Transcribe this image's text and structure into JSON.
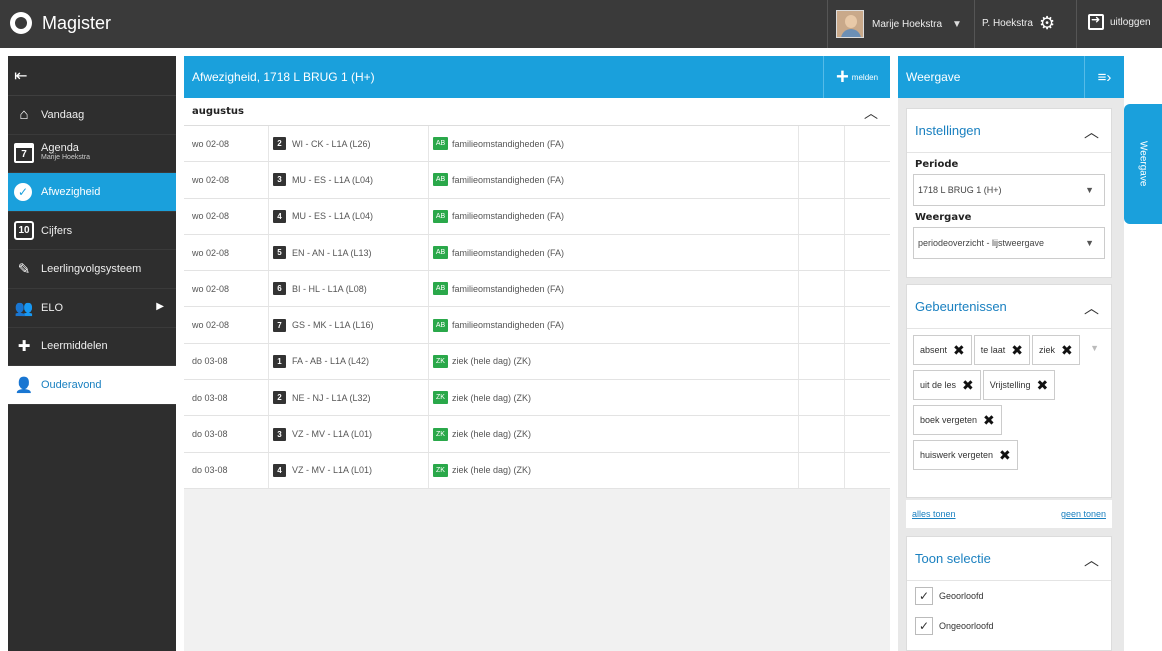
{
  "app": {
    "name": "Magister"
  },
  "topbar": {
    "user_name": "Marije Hoekstra",
    "account_name": "P. Hoekstra",
    "logout_label": "uitloggen"
  },
  "sidebar": {
    "items": [
      {
        "label": "Vandaag",
        "icon": "house-icon"
      },
      {
        "label": "Agenda",
        "sub": "Marije Hoekstra",
        "icon": "calendar-icon",
        "icon_text": "7"
      },
      {
        "label": "Afwezigheid",
        "icon": "check-circle-icon"
      },
      {
        "label": "Cijfers",
        "icon": "grade-icon",
        "icon_text": "10"
      },
      {
        "label": "Leerlingvolgsysteem",
        "icon": "pencil-icon"
      },
      {
        "label": "ELO",
        "icon": "people-icon"
      },
      {
        "label": "Leermiddelen",
        "icon": "puzzle-icon"
      },
      {
        "label": "Ouderavond",
        "icon": "parent-icon"
      }
    ],
    "active_index": 2,
    "selected_index": 7
  },
  "main": {
    "title": "Afwezigheid, 1718 L BRUG 1 (H+)",
    "melden_label": "melden",
    "month": "augustus",
    "rows": [
      {
        "date": "wo 02-08",
        "hour": "2",
        "les": "WI - CK - L1A (L26)",
        "code": "AB",
        "reason": "familieomstandigheden (FA)"
      },
      {
        "date": "wo 02-08",
        "hour": "3",
        "les": "MU - ES - L1A (L04)",
        "code": "AB",
        "reason": "familieomstandigheden (FA)"
      },
      {
        "date": "wo 02-08",
        "hour": "4",
        "les": "MU - ES - L1A (L04)",
        "code": "AB",
        "reason": "familieomstandigheden (FA)"
      },
      {
        "date": "wo 02-08",
        "hour": "5",
        "les": "EN - AN - L1A (L13)",
        "code": "AB",
        "reason": "familieomstandigheden (FA)"
      },
      {
        "date": "wo 02-08",
        "hour": "6",
        "les": "BI - HL - L1A (L08)",
        "code": "AB",
        "reason": "familieomstandigheden (FA)"
      },
      {
        "date": "wo 02-08",
        "hour": "7",
        "les": "GS - MK - L1A (L16)",
        "code": "AB",
        "reason": "familieomstandigheden (FA)"
      },
      {
        "date": "do 03-08",
        "hour": "1",
        "les": "FA - AB - L1A (L42)",
        "code": "ZK",
        "reason": "ziek (hele dag) (ZK)"
      },
      {
        "date": "do 03-08",
        "hour": "2",
        "les": "NE - NJ - L1A (L32)",
        "code": "ZK",
        "reason": "ziek (hele dag) (ZK)"
      },
      {
        "date": "do 03-08",
        "hour": "3",
        "les": "VZ - MV - L1A (L01)",
        "code": "ZK",
        "reason": "ziek (hele dag) (ZK)"
      },
      {
        "date": "do 03-08",
        "hour": "4",
        "les": "VZ - MV - L1A (L01)",
        "code": "ZK",
        "reason": "ziek (hele dag) (ZK)"
      }
    ]
  },
  "panel": {
    "title": "Weergave",
    "side_tab_label": "Weergave",
    "instellingen": {
      "title": "Instellingen",
      "periode_label": "Periode",
      "periode_value": "1718 L BRUG 1 (H+)",
      "weergave_label": "Weergave",
      "weergave_value": "periodeoverzicht - lijstweergave"
    },
    "gebeurtenissen": {
      "title": "Gebeurtenissen",
      "tags": [
        "absent",
        "te laat",
        "ziek",
        "uit de les",
        "Vrijstelling",
        "boek vergeten",
        "huiswerk vergeten"
      ]
    },
    "links": {
      "all": "alles tonen",
      "none": "geen tonen"
    },
    "toon_selectie": {
      "title": "Toon selectie",
      "options": [
        "Geoorloofd",
        "Ongeoorloofd"
      ]
    }
  },
  "colors": {
    "accent": "#1aa0dc",
    "topbar": "#3a3a3a",
    "sidebar": "#2e2e2e",
    "badge_green": "#2aa84a"
  }
}
